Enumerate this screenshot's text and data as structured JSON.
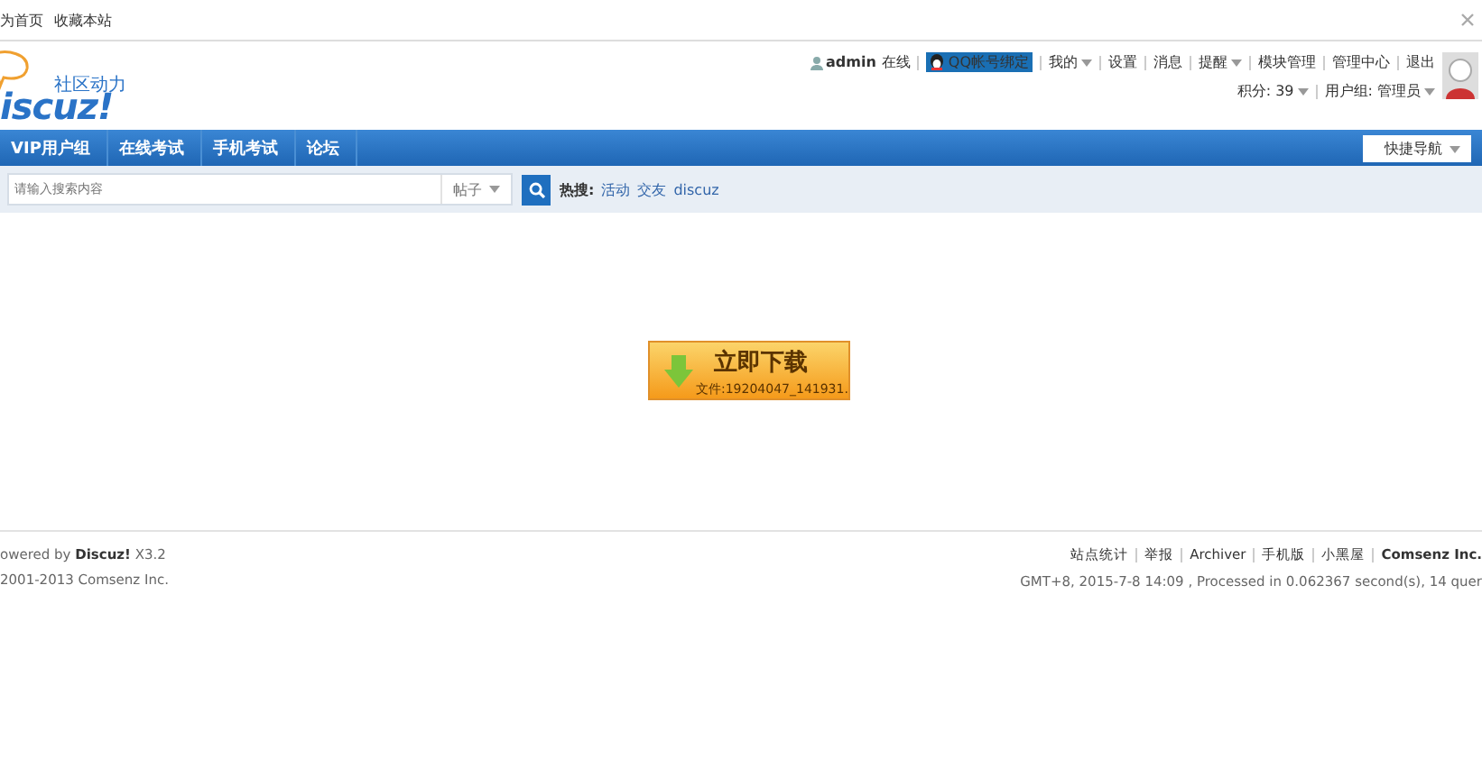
{
  "topbar": {
    "links": [
      "为首页",
      "收藏本站"
    ]
  },
  "header": {
    "slogan": "社区动力",
    "wordmark": "iscuz!",
    "user": {
      "username": "admin",
      "status": "在线",
      "qq_bind": "QQ帐号绑定",
      "menu": [
        {
          "label": "我的",
          "dropdown": true
        },
        {
          "label": "设置",
          "dropdown": false
        },
        {
          "label": "消息",
          "dropdown": false
        },
        {
          "label": "提醒",
          "dropdown": true
        },
        {
          "label": "模块管理",
          "dropdown": false
        },
        {
          "label": "管理中心",
          "dropdown": false
        },
        {
          "label": "退出",
          "dropdown": false
        }
      ],
      "stats": [
        {
          "label": "积分: 39",
          "dropdown": true
        },
        {
          "label": "用户组: 管理员",
          "dropdown": true
        }
      ]
    }
  },
  "nav": {
    "items": [
      "VIP用户组",
      "在线考试",
      "手机考试",
      "论坛"
    ],
    "quick_nav": "快捷导航"
  },
  "search": {
    "placeholder": "请输入搜索内容",
    "type": "帖子",
    "hot_label": "热搜:",
    "hot": [
      "活动",
      "交友",
      "discuz"
    ]
  },
  "download": {
    "title": "立即下载",
    "file": "文件:19204047_141931."
  },
  "footer": {
    "powered": "owered by **Discuz!** X3.2",
    "copyright": "2001-2013 Comsenz Inc.",
    "links": [
      "站点统计",
      "举报",
      "Archiver",
      "手机版",
      "小黑屋"
    ],
    "company": "Comsenz Inc.",
    "stats": "GMT+8, 2015-7-8 14:09 , Processed in 0.062367 second(s), 14 quer"
  }
}
